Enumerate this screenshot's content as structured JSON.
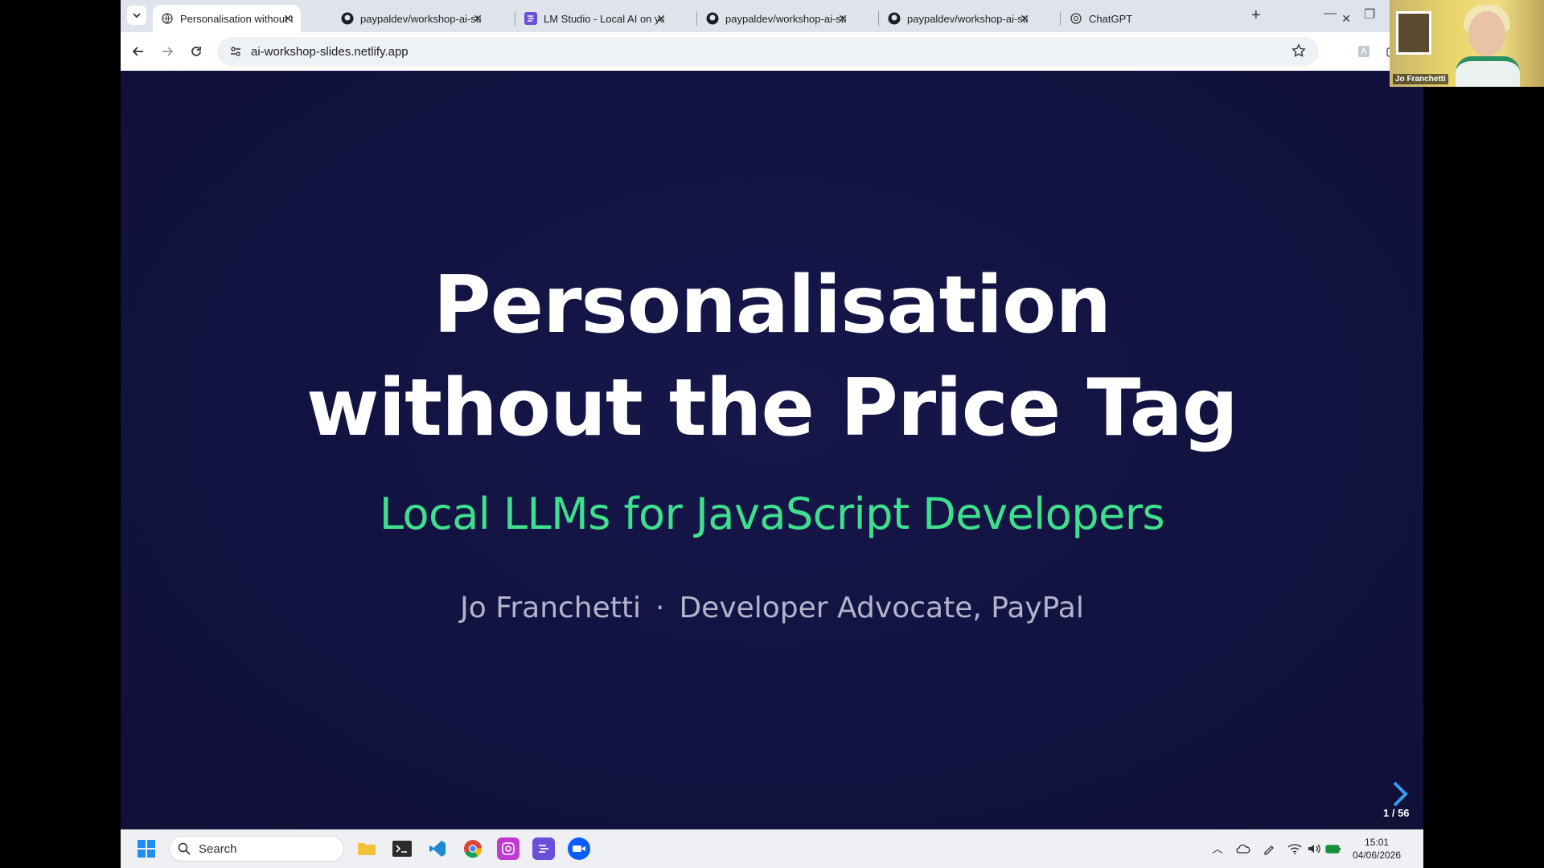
{
  "browser": {
    "tabs": [
      {
        "label": "Personalisation without the Price Tag",
        "icon": "globe-icon",
        "active": true
      },
      {
        "label": "paypaldev/workshop-ai-stag",
        "icon": "github-icon",
        "active": false
      },
      {
        "label": "LM Studio - Local AI on your",
        "icon": "lmstudio-icon",
        "active": false
      },
      {
        "label": "paypaldev/workshop-ai-stag",
        "icon": "github-icon",
        "active": false
      },
      {
        "label": "paypaldev/workshop-ai-stag",
        "icon": "github-icon",
        "active": false
      },
      {
        "label": "ChatGPT",
        "icon": "chatgpt-icon",
        "active": false
      }
    ],
    "url": "ai-workshop-slides.netlify.app"
  },
  "slide": {
    "title_line1": "Personalisation",
    "title_line2": "without the Price Tag",
    "subtitle": "Local LLMs for JavaScript Developers",
    "author": "Jo Franchetti",
    "separator": "·",
    "role": "Developer Advocate, PayPal",
    "counter": "1 / 56",
    "accent_color": "#3ee08d",
    "background_color": "#121240"
  },
  "taskbar": {
    "search_placeholder": "Search",
    "time": "15:01",
    "date": "04/06/2026"
  },
  "webcam": {
    "name": "Jo Franchetti"
  }
}
